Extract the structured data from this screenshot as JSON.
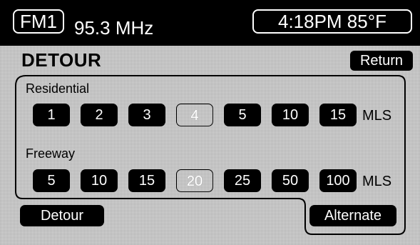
{
  "header": {
    "band": "FM1",
    "frequency": "95.3 MHz",
    "clock": "4:18PM 85°F"
  },
  "title": "DETOUR",
  "return_label": "Return",
  "residential": {
    "label": "Residential",
    "options": [
      {
        "label": "1",
        "enabled": true
      },
      {
        "label": "2",
        "enabled": true
      },
      {
        "label": "3",
        "enabled": true
      },
      {
        "label": "4",
        "enabled": false
      },
      {
        "label": "5",
        "enabled": true
      },
      {
        "label": "10",
        "enabled": true
      },
      {
        "label": "15",
        "enabled": true
      }
    ],
    "unit": "MLS"
  },
  "freeway": {
    "label": "Freeway",
    "options": [
      {
        "label": "5",
        "enabled": true
      },
      {
        "label": "10",
        "enabled": true
      },
      {
        "label": "15",
        "enabled": true
      },
      {
        "label": "20",
        "enabled": false
      },
      {
        "label": "25",
        "enabled": true
      },
      {
        "label": "50",
        "enabled": true
      },
      {
        "label": "100",
        "enabled": true
      }
    ],
    "unit": "MLS"
  },
  "buttons": {
    "detour": "Detour",
    "alternate": "Alternate"
  }
}
